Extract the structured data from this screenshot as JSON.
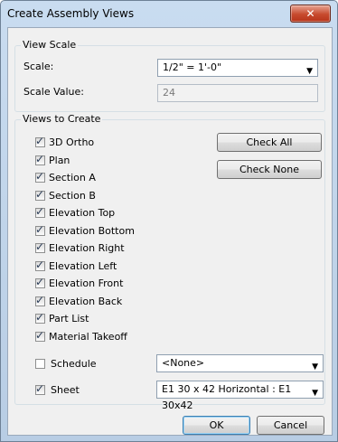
{
  "window": {
    "title": "Create Assembly Views",
    "close_glyph": "✕"
  },
  "view_scale": {
    "group_label": "View Scale",
    "scale_label": "Scale:",
    "scale_value_selected": "1/2\" = 1'-0\"",
    "scale_value_label": "Scale Value:",
    "scale_value": "24"
  },
  "views": {
    "group_label": "Views to Create",
    "items": [
      {
        "label": "3D Ortho",
        "checked": true
      },
      {
        "label": "Plan",
        "checked": true
      },
      {
        "label": "Section A",
        "checked": true
      },
      {
        "label": "Section B",
        "checked": true
      },
      {
        "label": "Elevation Top",
        "checked": true
      },
      {
        "label": "Elevation Bottom",
        "checked": true
      },
      {
        "label": "Elevation Right",
        "checked": true
      },
      {
        "label": "Elevation Left",
        "checked": true
      },
      {
        "label": "Elevation Front",
        "checked": true
      },
      {
        "label": "Elevation Back",
        "checked": true
      },
      {
        "label": "Part List",
        "checked": true
      },
      {
        "label": "Material Takeoff",
        "checked": true
      }
    ],
    "check_all_label": "Check All",
    "check_none_label": "Check None",
    "schedule": {
      "label": "Schedule",
      "checked": false,
      "selected": "<None>"
    },
    "sheet": {
      "label": "Sheet",
      "checked": true,
      "selected": "E1 30 x 42 Horizontal : E1 30x42"
    }
  },
  "footer": {
    "ok_label": "OK",
    "cancel_label": "Cancel"
  },
  "icons": {
    "dropdown": "chevron-down-icon",
    "check": "checkmark-icon",
    "close": "close-icon"
  },
  "colors": {
    "titlebar": "#c9dcf0",
    "close_button": "#c74a2e",
    "dialog_bg": "#f0f0f0"
  }
}
